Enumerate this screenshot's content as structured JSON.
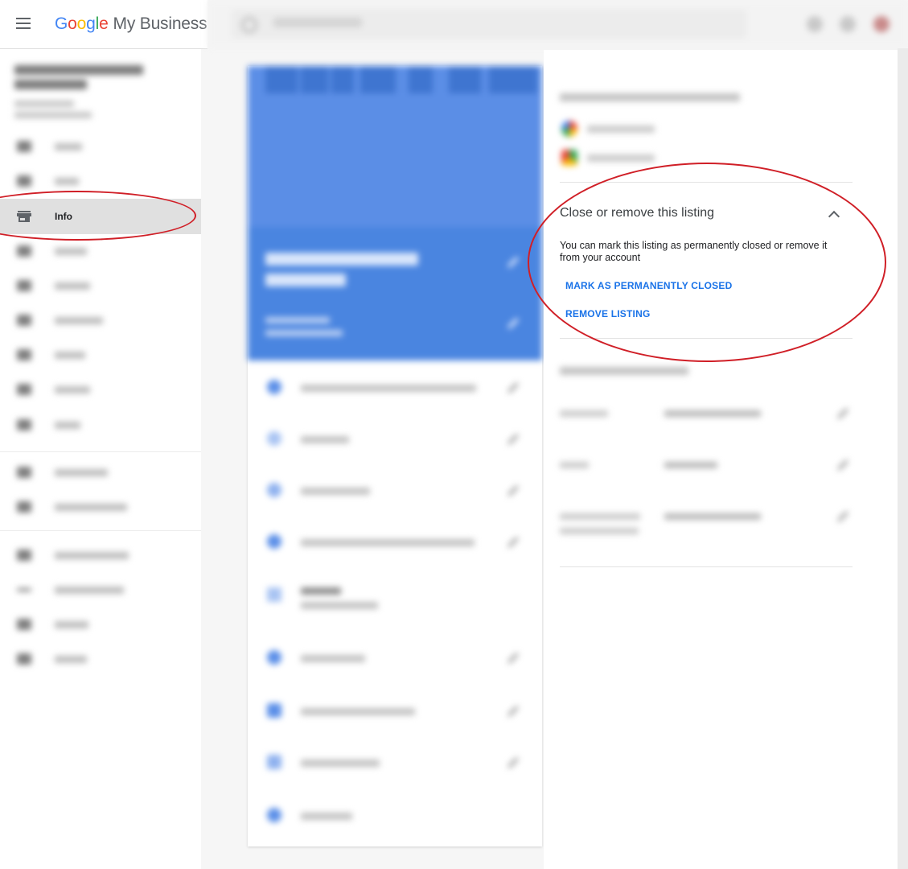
{
  "header": {
    "logo_google": [
      "G",
      "o",
      "o",
      "g",
      "l",
      "e"
    ],
    "logo_product": "My Business"
  },
  "sidebar": {
    "active_item": {
      "label": "Info",
      "icon": "storefront-icon"
    },
    "items_count_visible": 16
  },
  "right_panel": {
    "close_section": {
      "title": "Close or remove this listing",
      "description": "You can mark this listing as permanently closed or remove it from your account",
      "mark_closed_label": "MARK AS PERMANENTLY CLOSED",
      "remove_label": "REMOVE LISTING"
    }
  },
  "colors": {
    "accent": "#1a73e8",
    "hero_blue": "#4a85e0",
    "annotation_red": "#d01f27",
    "active_nav_bg": "#e0e0e0"
  }
}
